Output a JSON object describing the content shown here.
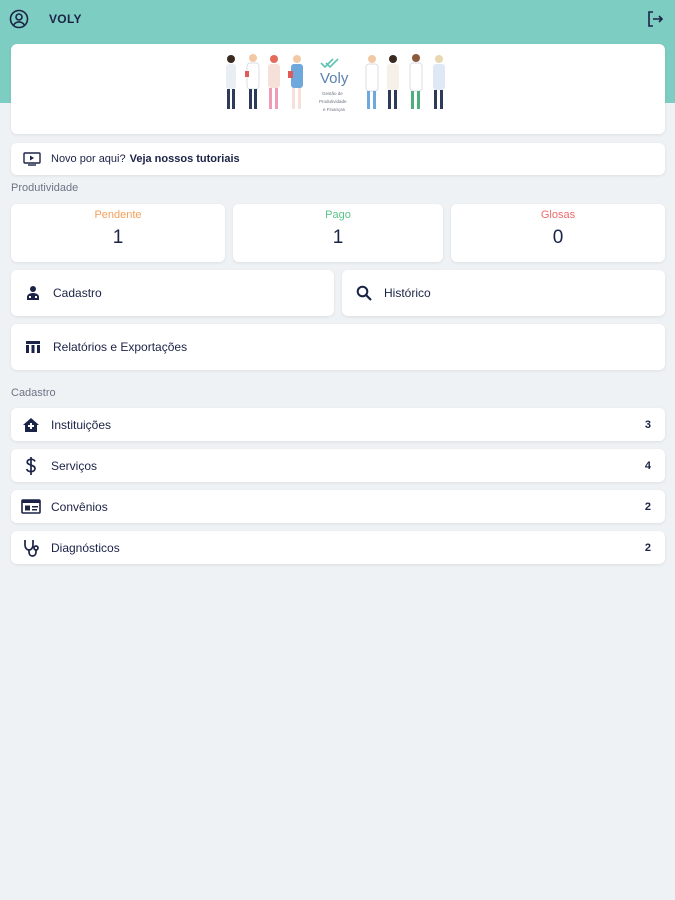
{
  "header": {
    "title": "VOLY",
    "avatar_icon": "user-circle-icon",
    "logout_icon": "logout-icon"
  },
  "banner": {
    "logo_text": "Voly",
    "tagline_1": "Gestão de",
    "tagline_2": "Produtividade",
    "tagline_3": "e Finanças"
  },
  "tutorial": {
    "icon": "play-video-icon",
    "text": "Novo por aqui?",
    "link": "Veja nossos tutoriais"
  },
  "productivity": {
    "section_label": "Produtividade",
    "stats": [
      {
        "label": "Pendente",
        "value": "1",
        "color": "#f3a05a"
      },
      {
        "label": "Pago",
        "value": "1",
        "color": "#5cc48a"
      },
      {
        "label": "Glosas",
        "value": "0",
        "color": "#ef6b6b"
      }
    ]
  },
  "actions": {
    "cadastro": {
      "label": "Cadastro",
      "icon": "users-icon"
    },
    "historico": {
      "label": "Histórico",
      "icon": "search-icon"
    },
    "relatorios": {
      "label": "Relatórios e Exportações",
      "icon": "table-icon"
    }
  },
  "cadastro": {
    "section_label": "Cadastro",
    "items": [
      {
        "label": "Instituições",
        "count": "3",
        "icon": "hospital-icon"
      },
      {
        "label": "Serviços",
        "count": "4",
        "icon": "dollar-icon"
      },
      {
        "label": "Convênios",
        "count": "2",
        "icon": "id-card-icon"
      },
      {
        "label": "Diagnósticos",
        "count": "2",
        "icon": "stethoscope-icon"
      }
    ]
  },
  "colors": {
    "header_bg": "#7ecdc2",
    "navy": "#1b2346",
    "page_bg": "#eff2f5"
  }
}
